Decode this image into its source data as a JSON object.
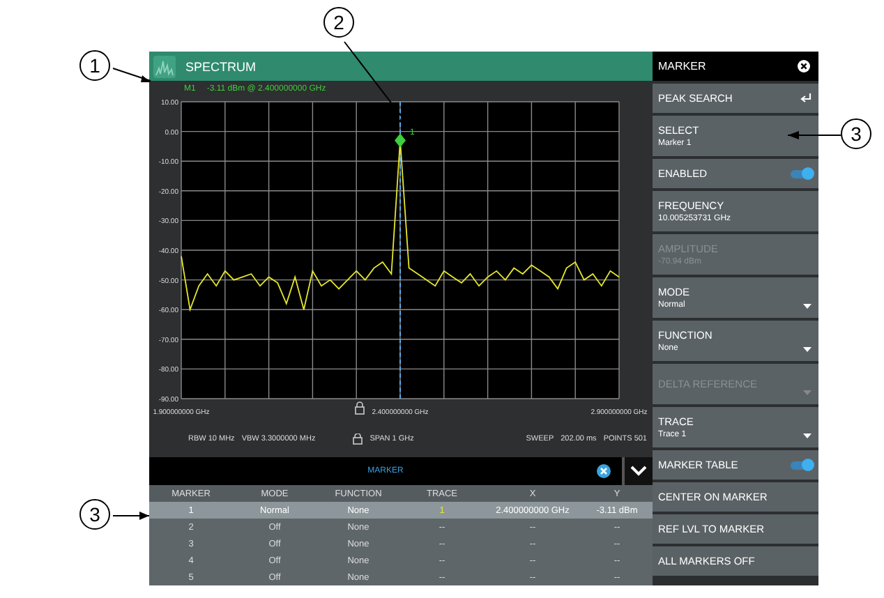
{
  "window": {
    "title": "SPECTRUM"
  },
  "readout": {
    "marker": "M1",
    "value": "-3.11 dBm @ 2.400000000 GHz"
  },
  "chart": {
    "chart_data": {
      "type": "line",
      "grid": true,
      "xlim": [
        1.9,
        2.9
      ],
      "ylim": [
        -90,
        10
      ],
      "xticks": [
        {
          "value": 1.9,
          "label": "1.900000000 GHz"
        },
        {
          "value": 2.4,
          "label": "2.400000000 GHz"
        },
        {
          "value": 2.9,
          "label": "2.900000000 GHz"
        }
      ],
      "yticks": [
        {
          "value": 10,
          "label": "10.00"
        },
        {
          "value": 0,
          "label": "0.00"
        },
        {
          "value": -10,
          "label": "-10.00"
        },
        {
          "value": -20,
          "label": "-20.00"
        },
        {
          "value": -30,
          "label": "-30.00"
        },
        {
          "value": -40,
          "label": "-40.00"
        },
        {
          "value": -50,
          "label": "-50.00"
        },
        {
          "value": -60,
          "label": "-60.00"
        },
        {
          "value": -70,
          "label": "-70.00"
        },
        {
          "value": -80,
          "label": "-80.00"
        },
        {
          "value": -90,
          "label": "-90.00"
        }
      ],
      "x": [
        1.9,
        1.92,
        1.94,
        1.96,
        1.98,
        2.0,
        2.02,
        2.04,
        2.06,
        2.08,
        2.1,
        2.12,
        2.14,
        2.16,
        2.18,
        2.2,
        2.22,
        2.24,
        2.26,
        2.28,
        2.3,
        2.32,
        2.34,
        2.36,
        2.38,
        2.4,
        2.42,
        2.44,
        2.46,
        2.48,
        2.5,
        2.52,
        2.54,
        2.56,
        2.58,
        2.6,
        2.62,
        2.64,
        2.66,
        2.68,
        2.7,
        2.72,
        2.74,
        2.76,
        2.78,
        2.8,
        2.82,
        2.84,
        2.86,
        2.88,
        2.9
      ],
      "series": [
        {
          "color": "#e6e62e",
          "values": [
            -42,
            -60,
            -52,
            -48,
            -52,
            -47,
            -50,
            -49,
            -48,
            -52,
            -49,
            -51,
            -58,
            -49,
            -60,
            -47,
            -52,
            -50,
            -53,
            -50,
            -47,
            -50,
            -46,
            -44,
            -48,
            -3,
            -46,
            -48,
            -50,
            -52,
            -47,
            -49,
            -51,
            -48,
            -52,
            -49,
            -47,
            -50,
            -46,
            -48,
            -45,
            -47,
            -49,
            -53,
            -46,
            -44,
            -50,
            -48,
            -52,
            -47,
            -49
          ]
        }
      ],
      "ref_lines": [
        {
          "axis": "x",
          "value": 2.4,
          "color": "#5aa9e6"
        }
      ],
      "annotations": [
        {
          "text": "1",
          "x": 2.4,
          "y": -3
        }
      ]
    }
  },
  "settings": {
    "rbw": "RBW 10 MHz",
    "vbw": "VBW 3.3000000 MHz",
    "span": "SPAN 1 GHz",
    "sweep": "SWEEP",
    "sweep_time": "202.00 ms",
    "points": "POINTS 501"
  },
  "marker_bar": {
    "title": "MARKER"
  },
  "table": {
    "columns": [
      "MARKER",
      "MODE",
      "FUNCTION",
      "TRACE",
      "X",
      "Y"
    ],
    "rows": [
      {
        "cells": [
          "1",
          "Normal",
          "None",
          "1",
          "2.400000000 GHz",
          "-3.11 dBm"
        ],
        "selected": true,
        "color": "#e6e62e"
      },
      {
        "cells": [
          "2",
          "Off",
          "None",
          "--",
          "--",
          "--"
        ],
        "selected": false
      },
      {
        "cells": [
          "3",
          "Off",
          "None",
          "--",
          "--",
          "--"
        ],
        "selected": false
      },
      {
        "cells": [
          "4",
          "Off",
          "None",
          "--",
          "--",
          "--"
        ],
        "selected": false
      },
      {
        "cells": [
          "5",
          "Off",
          "None",
          "--",
          "--",
          "--"
        ],
        "selected": false
      }
    ]
  },
  "panel": {
    "title": "MARKER",
    "items": [
      {
        "kind": "action",
        "label": "PEAK SEARCH",
        "enter": true,
        "disabled": false
      },
      {
        "kind": "value",
        "label": "SELECT",
        "value": "Marker 1",
        "disabled": false
      },
      {
        "kind": "toggle",
        "label": "ENABLED",
        "on": true,
        "disabled": false
      },
      {
        "kind": "value",
        "label": "FREQUENCY",
        "value": "10.005253731 GHz",
        "disabled": false
      },
      {
        "kind": "value",
        "label": "AMPLITUDE",
        "value": "-70.94 dBm",
        "disabled": true
      },
      {
        "kind": "dropdown",
        "label": "MODE",
        "value": "Normal",
        "disabled": false
      },
      {
        "kind": "dropdown",
        "label": "FUNCTION",
        "value": "None",
        "disabled": false
      },
      {
        "kind": "dropdown",
        "label": "DELTA REFERENCE",
        "disabled": true
      },
      {
        "kind": "dropdown",
        "label": "TRACE",
        "value": "Trace 1",
        "disabled": false
      },
      {
        "kind": "toggle",
        "label": "MARKER TABLE",
        "on": true,
        "disabled": false
      },
      {
        "kind": "action",
        "label": "CENTER ON MARKER",
        "disabled": false
      },
      {
        "kind": "action",
        "label": "REF LVL TO MARKER",
        "disabled": false
      },
      {
        "kind": "action",
        "label": "ALL MARKERS OFF",
        "disabled": false
      }
    ]
  },
  "callouts": [
    {
      "label": "1"
    },
    {
      "label": "2"
    },
    {
      "label": "3"
    },
    {
      "label": "3"
    }
  ]
}
